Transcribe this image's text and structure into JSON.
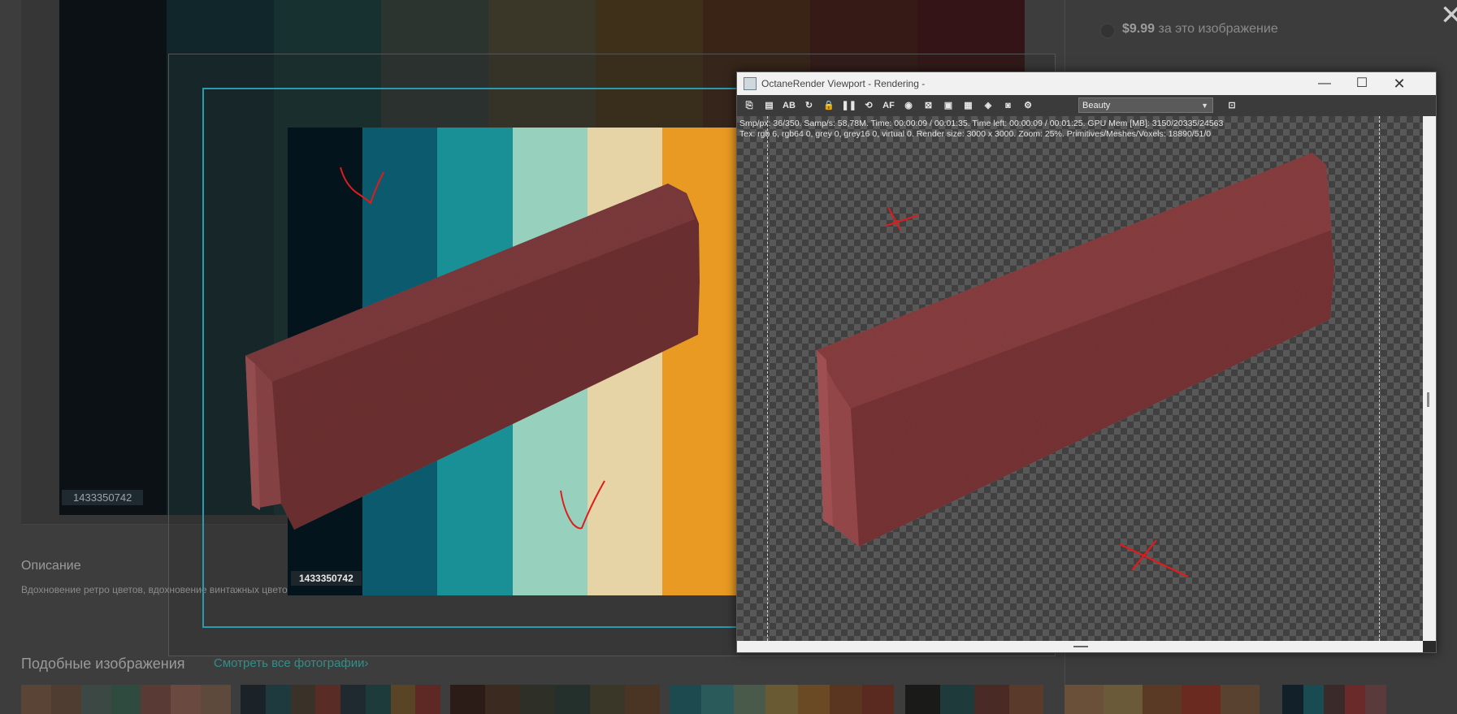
{
  "background_page": {
    "price": "$9.99",
    "price_suffix": "за это изображение",
    "image_id": "1433350742",
    "description_title": "Описание",
    "description_text": "Вдохновение ретро цветов, вдохновение винтажных цвето",
    "similar_title": "Подобные изображения",
    "similar_link": "Смотреть все фотографии›",
    "close_glyph": "✕"
  },
  "palette": {
    "image_id": "1433350742",
    "stripes": [
      "#04141d",
      "#0c5a6e",
      "#198f96",
      "#98d0be",
      "#e6d3a6",
      "#e89a22"
    ]
  },
  "octane": {
    "title": "OctaneRender Viewport - Rendering -",
    "buttons": {
      "minimize": "—",
      "maximize": "☐",
      "close": "✕"
    },
    "render_pass": "Beauty",
    "stats_line1": "Smp/px: 36/350.   Samp/s: 58,78M.   Time: 00:00:09 / 00:01:35.   Time left: 00:00:09 / 00:01:25.   GPU Mem [MB]: 3150/20335/24563",
    "stats_line2": "Tex: rgb 6, rgb64 0, grey 0, grey16 0, virtual 0.   Render size: 3000 x 3000.   Zoom: 25%.   Primitives/Meshes/Voxels: 18890/51/0",
    "toolbar_icons": [
      {
        "name": "copy-clipboard-icon",
        "glyph": "⎘"
      },
      {
        "name": "save-image-icon",
        "glyph": "▤"
      },
      {
        "name": "ab-compare-icon",
        "glyph": "AB"
      },
      {
        "name": "restart-render-icon",
        "glyph": "↻"
      },
      {
        "name": "lock-icon",
        "glyph": "🔒"
      },
      {
        "name": "pause-icon",
        "glyph": "❚❚"
      },
      {
        "name": "recenter-icon",
        "glyph": "⟲"
      },
      {
        "name": "autofocus-icon",
        "glyph": "AF"
      },
      {
        "name": "color-picker-icon",
        "glyph": "◉"
      },
      {
        "name": "region-render-icon",
        "glyph": "⊠"
      },
      {
        "name": "film-region-icon",
        "glyph": "▣"
      },
      {
        "name": "display-settings-icon",
        "glyph": "▦"
      },
      {
        "name": "material-picker-icon",
        "glyph": "◈"
      },
      {
        "name": "camera-icon",
        "glyph": "◙"
      },
      {
        "name": "settings-gear-icon",
        "glyph": "⚙"
      }
    ],
    "extra_icon": {
      "name": "viewport-resize-icon",
      "glyph": "⊡"
    }
  },
  "annotations": {
    "marks": [
      "check",
      "check",
      "cross",
      "cross"
    ],
    "color": "#e01b1b"
  },
  "colors": {
    "brick": "#7a3436",
    "selection": "#2a9ab0"
  }
}
